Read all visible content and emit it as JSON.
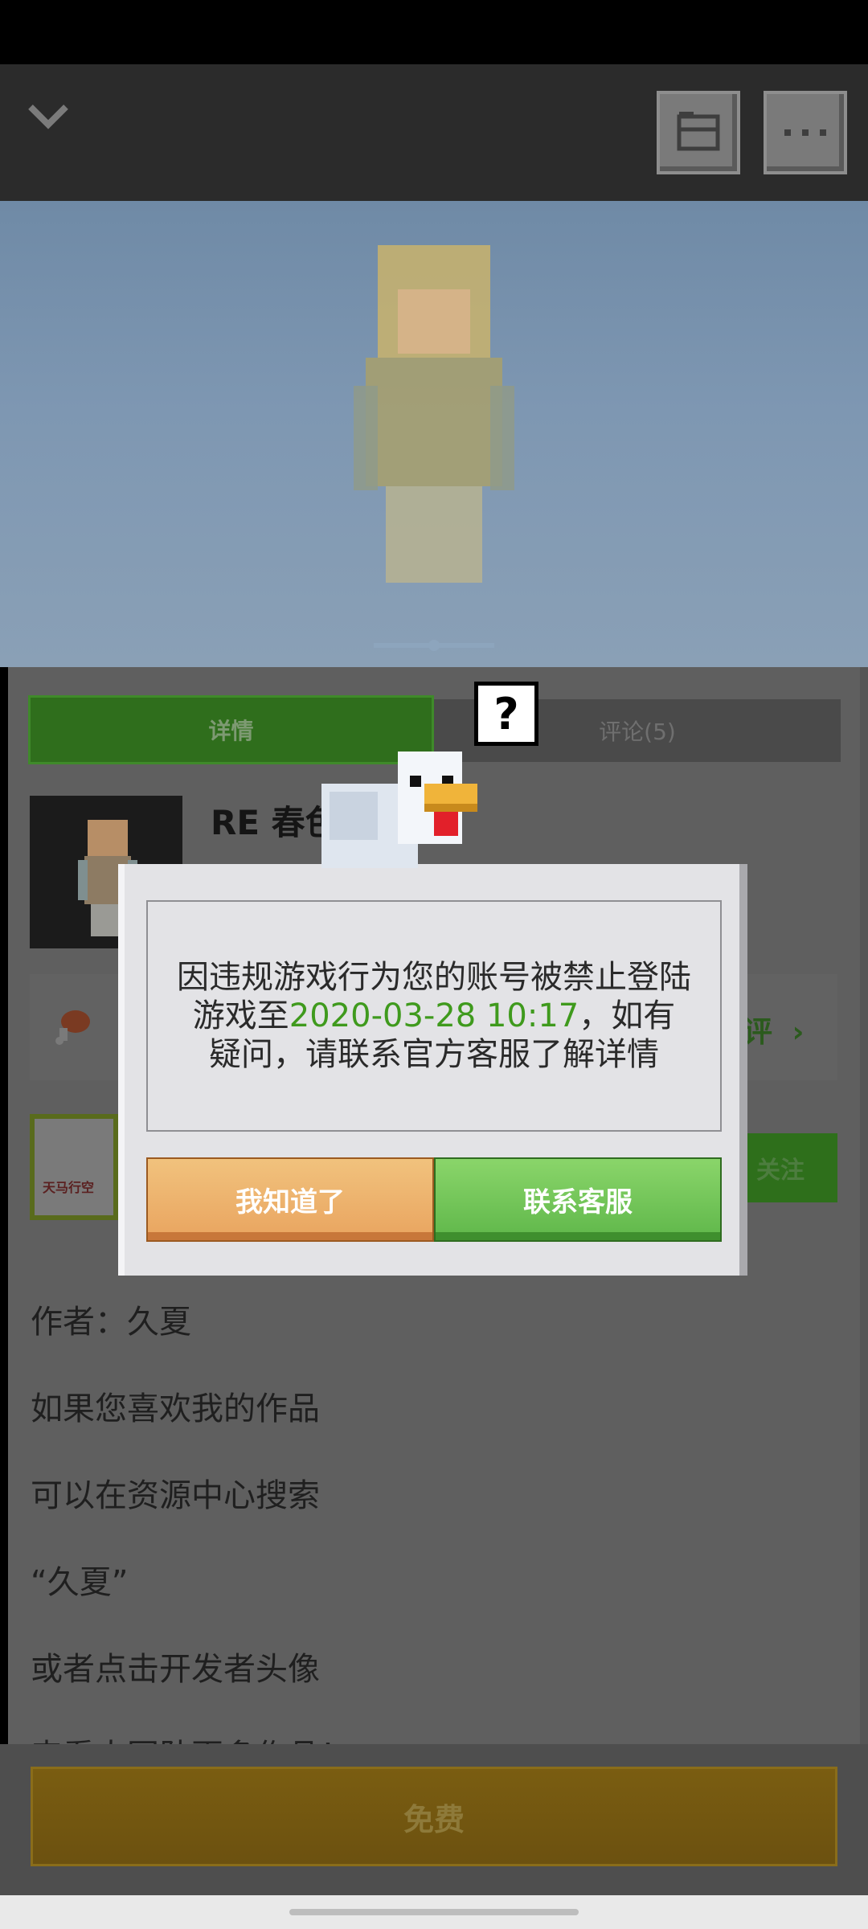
{
  "header": {
    "back_icon": "chevron-down-icon",
    "save_icon": "folder-icon",
    "more_icon": "ellipsis-icon"
  },
  "tabs": {
    "details": "详情",
    "comments": "评论(5)"
  },
  "item": {
    "title": "RE 春色",
    "rate_label": "评",
    "rate_icon": "drumstick-icon",
    "follow_label": "关注",
    "developer_logo_text": "天马行空"
  },
  "description": [
    "作者：久夏",
    "如果您喜欢我的作品",
    "可以在资源中心搜索",
    "“久夏”",
    "或者点击开发者头像",
    "来看大团队更多作品！"
  ],
  "bottom": {
    "free_label": "免费"
  },
  "dialog": {
    "message_pre": "因违规游戏行为您的账号被禁止登陆游戏至",
    "message_date": "2020-03-28 10:17",
    "message_post": "，如有疑问，请联系官方客服了解详情",
    "ok_label": "我知道了",
    "support_label": "联系客服",
    "bubble": "?"
  },
  "colors": {
    "accent_green": "#5fb74a",
    "date_green": "#3f9a1d",
    "ok_orange": "#e9a45f",
    "free_gold": "#7a5d11"
  }
}
